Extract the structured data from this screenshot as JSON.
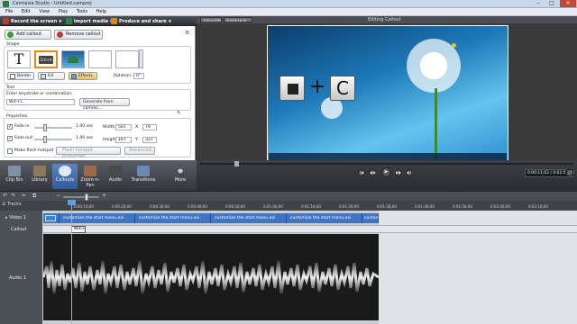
{
  "window": {
    "title": "Camtasia Studio - Untitled.camproj",
    "controls": [
      "–",
      "□",
      "✕"
    ]
  },
  "menu": [
    "File",
    "Edit",
    "View",
    "Play",
    "Tools",
    "Help"
  ],
  "toolbar": {
    "record": "Record the screen",
    "import": "Import media",
    "produce": "Produce and share"
  },
  "callout": {
    "add_label": "Add callout",
    "remove_label": "Remove callout",
    "shape_title": "Shape",
    "border_label": "Border",
    "fill_label": "Fill",
    "effects_label": "Effects",
    "rotation_label": "Rotation:",
    "rotation_value": "0°",
    "text_title": "Text",
    "keystroke_label": "Enter keystroke or combination:",
    "keystroke_value": "Win+C",
    "capture_button": "Generate from camrec...",
    "properties_title": "Properties",
    "fade_in_label": "Fade in:",
    "fade_in_value": "1.00 sec",
    "fade_out_label": "Fade out:",
    "fade_out_value": "1.00 sec",
    "width_label": "Width:",
    "width_value": "501",
    "height_label": "Height:",
    "height_value": "167",
    "x_label": "X:",
    "x_value": "79",
    "y_label": "Y:",
    "y_value": "337",
    "hotspot_label": "Make flash hotspot",
    "hotspot_props": "Flash hotspot properties...",
    "advanced": "Advanced..."
  },
  "preview": {
    "size_select": "1920x1080",
    "zoom_select": "Shrink to fit",
    "title": "Editing Callout",
    "keystroke_keys": [
      "+",
      "C"
    ],
    "time_display": "0:00:11;02 / 0:02:51;11"
  },
  "tabs": [
    "Clip Bin",
    "Library",
    "Callouts",
    "Zoom-n-Pan",
    "Audio",
    "Transitions",
    "More"
  ],
  "timeline": {
    "tracks_label": "Tracks",
    "track_names": [
      "Video 1",
      "Callout",
      "Audio 1"
    ],
    "ruler": [
      "0:00:10;00",
      "0:00:20;00",
      "0:00:30;00",
      "0:00:40;00",
      "0:00:50;00",
      "0:01:00;00",
      "0:01:10;00",
      "0:01:20;00",
      "0:01:30;00",
      "0:01:40;00",
      "0:01:50;00",
      "0:02:00;00",
      "0:02:10;00"
    ],
    "clips": [
      "customize the start menu.avi",
      "customize the start menu.avi",
      "customize the start menu.avi",
      "customize the start menu.avi",
      "customize the start menu.avi",
      "customize t"
    ],
    "callout_clip": "Win+"
  },
  "colors": {
    "accent": "#3e76c4",
    "produce": "#d98a1f",
    "record": "#c0392b",
    "import": "#2d8a3a"
  }
}
